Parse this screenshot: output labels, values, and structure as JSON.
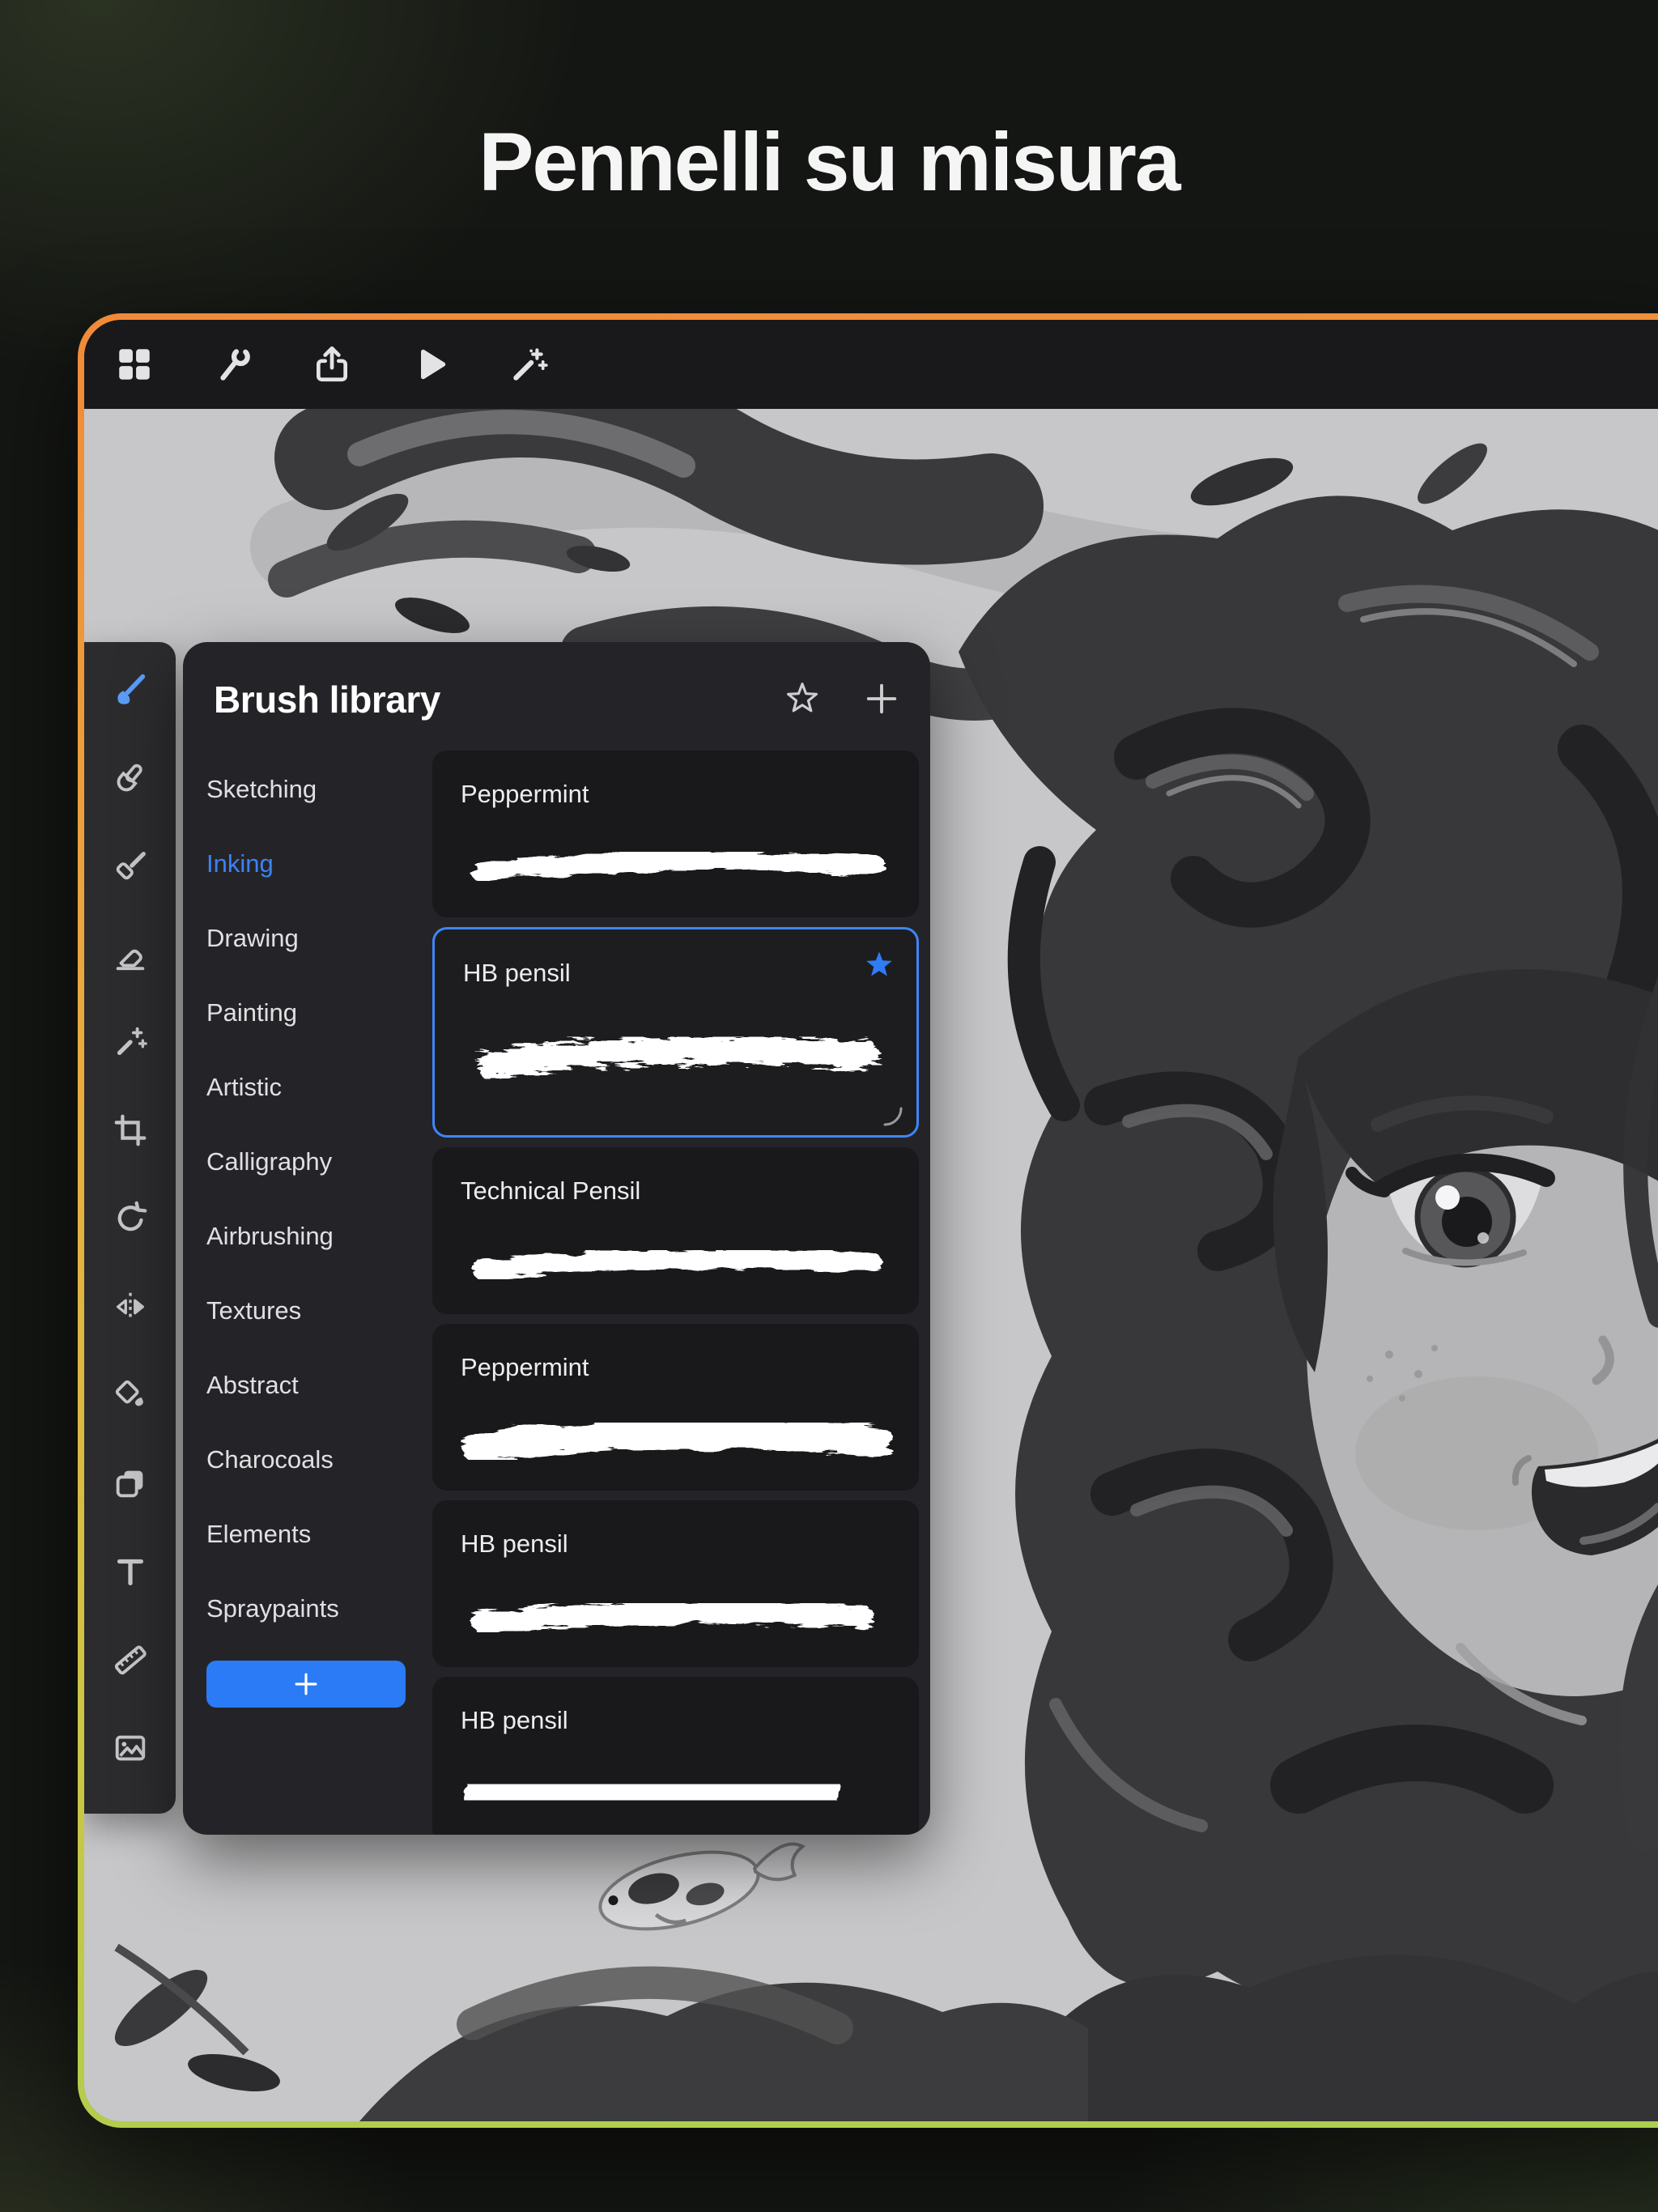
{
  "page": {
    "title": "Pennelli su misura"
  },
  "app_toolbar": {
    "buttons": [
      {
        "name": "gallery",
        "icon": "gallery-icon"
      },
      {
        "name": "actions",
        "icon": "wrench-icon"
      },
      {
        "name": "share",
        "icon": "share-icon"
      },
      {
        "name": "play",
        "icon": "play-icon"
      },
      {
        "name": "adjustments",
        "icon": "magic-wand-icon"
      }
    ]
  },
  "tool_sidebar": {
    "tools": [
      {
        "name": "paint",
        "icon": "brush-icon",
        "active": true
      },
      {
        "name": "smudge",
        "icon": "smudge-icon",
        "active": false
      },
      {
        "name": "flat-brush",
        "icon": "flat-brush-icon",
        "active": false
      },
      {
        "name": "erase",
        "icon": "eraser-icon",
        "active": false
      },
      {
        "name": "adjustments",
        "icon": "sparkle-wand-icon",
        "active": false
      },
      {
        "name": "crop",
        "icon": "crop-icon",
        "active": false
      },
      {
        "name": "transform",
        "icon": "rotate-arrow-icon",
        "active": false
      },
      {
        "name": "flip",
        "icon": "flip-icon",
        "active": false
      },
      {
        "name": "fill",
        "icon": "color-drop-icon",
        "active": false
      },
      {
        "name": "layers",
        "icon": "layers-icon",
        "active": false
      },
      {
        "name": "text",
        "icon": "text-icon",
        "active": false
      },
      {
        "name": "ruler",
        "icon": "ruler-icon",
        "active": false
      },
      {
        "name": "image",
        "icon": "image-icon",
        "active": false
      }
    ]
  },
  "brush_library": {
    "title": "Brush library",
    "header_icons": [
      "star-icon",
      "plus-icon"
    ],
    "categories": [
      {
        "label": "Sketching",
        "selected": false
      },
      {
        "label": "Inking",
        "selected": true
      },
      {
        "label": "Drawing",
        "selected": false
      },
      {
        "label": "Painting",
        "selected": false
      },
      {
        "label": "Artistic",
        "selected": false
      },
      {
        "label": "Calligraphy",
        "selected": false
      },
      {
        "label": "Airbrushing",
        "selected": false
      },
      {
        "label": "Textures",
        "selected": false
      },
      {
        "label": "Abstract",
        "selected": false
      },
      {
        "label": "Charocoals",
        "selected": false
      },
      {
        "label": "Elements",
        "selected": false
      },
      {
        "label": "Spraypaints",
        "selected": false
      }
    ],
    "add_category_icon": "plus-icon",
    "brushes": [
      {
        "name": "Peppermint",
        "selected": false,
        "starred": false
      },
      {
        "name": "HB pensil",
        "selected": true,
        "starred": true
      },
      {
        "name": "Technical Pensil",
        "selected": false,
        "starred": false
      },
      {
        "name": "Peppermint",
        "selected": false,
        "starred": false
      },
      {
        "name": "HB pensil",
        "selected": false,
        "starred": false
      },
      {
        "name": "HB pensil",
        "selected": false,
        "starred": false
      }
    ]
  },
  "colors": {
    "accent_blue": "#3b82f6",
    "frame_gradient_top": "#f08a39",
    "frame_gradient_bottom": "#abcf4e",
    "canvas_gray": "#c7c7c9"
  }
}
